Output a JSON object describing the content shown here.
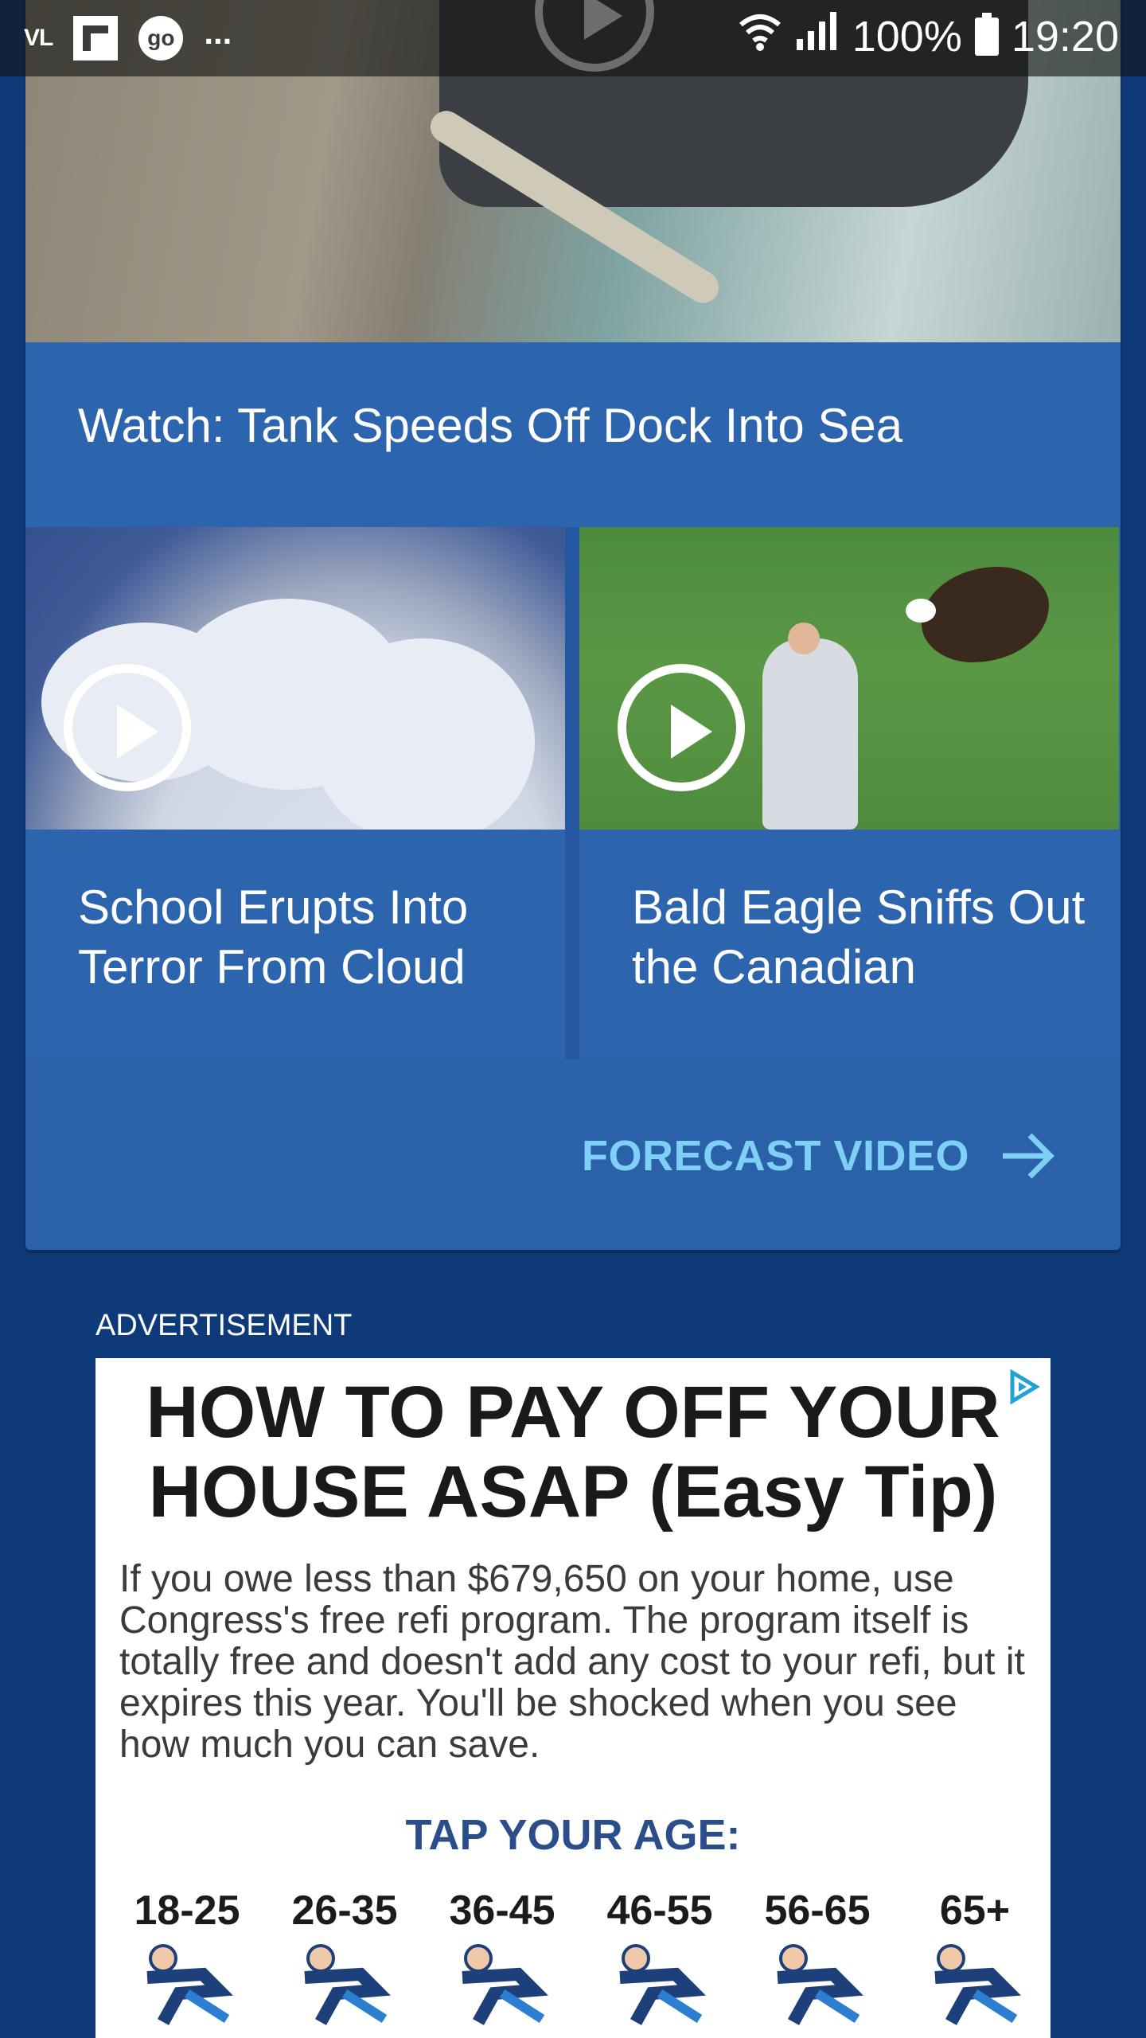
{
  "status_bar": {
    "left_icons": [
      "vl-icon",
      "flipboard-icon",
      "go-icon"
    ],
    "vl_text": "VL",
    "go_text": "go",
    "more_text": "...",
    "battery_text": "100%",
    "time": "19:20"
  },
  "video_card": {
    "hero_title": "Watch: Tank Speeds Off Dock Into Sea",
    "tiles": [
      {
        "title": "School Erupts Into Terror From Cloud"
      },
      {
        "title": "Bald Eagle Sniffs Out the Canadian"
      }
    ],
    "link_label": "FORECAST VIDEO"
  },
  "ad": {
    "label": "ADVERTISEMENT",
    "headline_line1": "HOW TO PAY OFF YOUR",
    "headline_line2": "HOUSE ASAP (Easy Tip)",
    "body": "If you owe less than $679,650 on your home, use Congress's free refi program. The program itself is totally free and doesn't add any cost to your refi, but it expires this year. You'll be shocked when you see how much you can save.",
    "cta": "TAP YOUR AGE:",
    "ages": [
      "18-25",
      "26-35",
      "36-45",
      "46-55",
      "56-65",
      "65+"
    ]
  },
  "colors": {
    "background": "#0f3a7a",
    "card": "#2c64ad",
    "link": "#7ed0f7",
    "ad_cta": "#2b4e8a"
  }
}
